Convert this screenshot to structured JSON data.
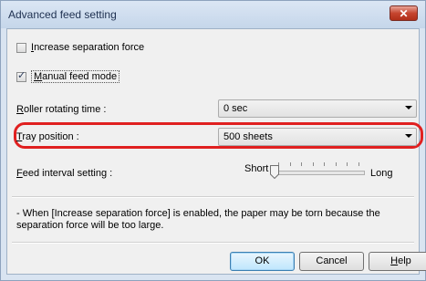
{
  "window": {
    "title": "Advanced feed setting",
    "close_glyph": "✕"
  },
  "options": {
    "increase_separation_force": {
      "label": "Increase separation force",
      "checked": false
    },
    "manual_feed_mode": {
      "label": "Manual feed mode",
      "checked": true
    }
  },
  "roller_rotating_time": {
    "label": "Roller rotating time :",
    "value": "0 sec"
  },
  "tray_position": {
    "label": "Tray position :",
    "value": "500 sheets"
  },
  "feed_interval": {
    "label": "Feed interval setting :",
    "min_label": "Short",
    "max_label": "Long",
    "tick_count": 8,
    "position": 0
  },
  "note": "- When [Increase separation force] is enabled, the paper may be torn because the separation force will be too large.",
  "buttons": {
    "ok": "OK",
    "cancel": "Cancel",
    "help": "Help"
  },
  "colors": {
    "highlight": "#e02020",
    "close_button": "#c6452f",
    "title_text": "#1e3050"
  }
}
